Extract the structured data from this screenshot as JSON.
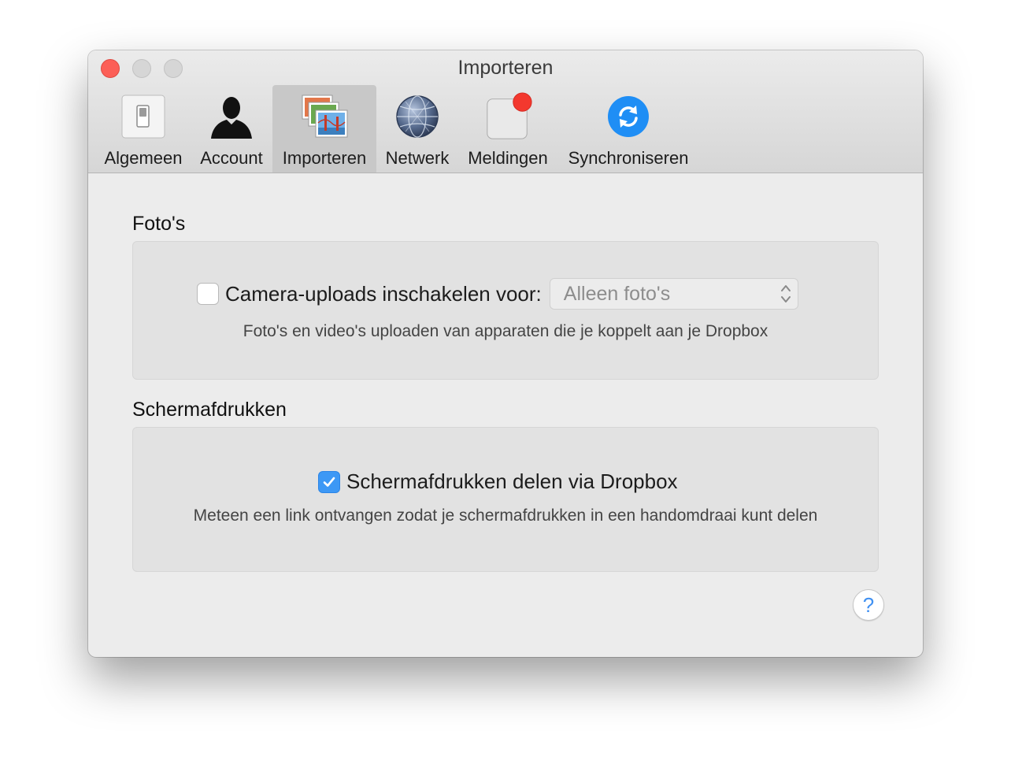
{
  "window": {
    "title": "Importeren"
  },
  "toolbar": {
    "tabs": [
      {
        "label": "Algemeen",
        "icon": "toggle-switch-icon"
      },
      {
        "label": "Account",
        "icon": "person-silhouette-icon"
      },
      {
        "label": "Importeren",
        "icon": "photos-stack-icon",
        "active": true
      },
      {
        "label": "Netwerk",
        "icon": "globe-network-icon"
      },
      {
        "label": "Meldingen",
        "icon": "notification-badge-icon"
      },
      {
        "label": "Synchroniseren",
        "icon": "sync-icon"
      }
    ]
  },
  "photos": {
    "section_title": "Foto's",
    "camera_uploads_label": "Camera-uploads inschakelen voor:",
    "camera_uploads_checked": false,
    "select_value": "Alleen foto's",
    "description": "Foto's en video's uploaden van apparaten die je koppelt aan je Dropbox"
  },
  "screenshots": {
    "section_title": "Schermafdrukken",
    "share_label": "Schermafdrukken delen via Dropbox",
    "share_checked": true,
    "description": "Meteen een link ontvangen zodat je schermafdrukken in een handomdraai kunt delen"
  },
  "help": {
    "label": "?"
  },
  "colors": {
    "accent": "#3d98f5",
    "close": "#fc5f57",
    "badge": "#f3382e",
    "sync": "#1f8ef5"
  }
}
